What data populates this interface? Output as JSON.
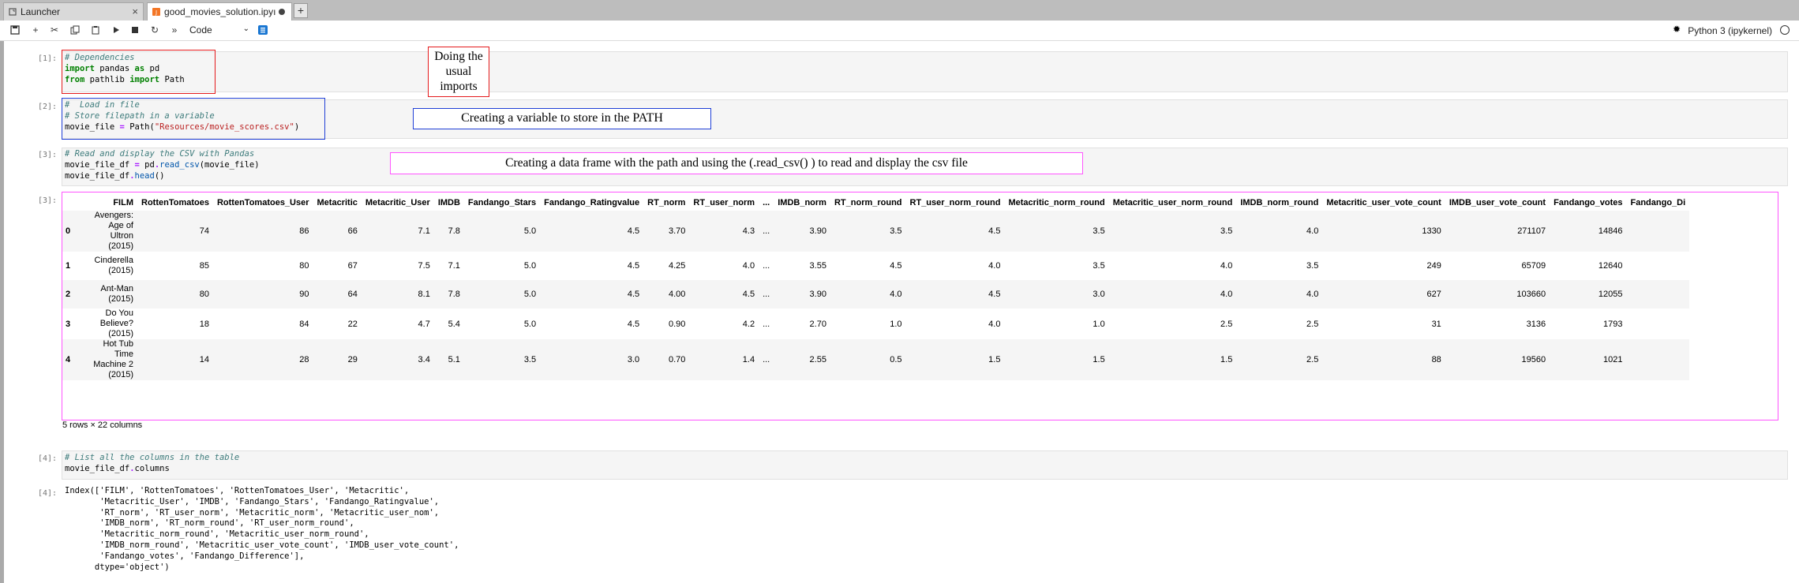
{
  "tabs": [
    {
      "label": "Launcher",
      "icon": "launcher-icon"
    },
    {
      "label": "good_movies_solution.ipyı",
      "icon": "notebook-icon"
    }
  ],
  "toolbar": {
    "cell_type": "Code",
    "kernel": "Python 3 (ipykernel)"
  },
  "cells": [
    {
      "prompt": "[1]:",
      "code": [
        "# Dependencies",
        "import pandas as pd",
        "from pathlib import Path"
      ]
    },
    {
      "prompt": "[2]:",
      "code": [
        "# Load in file",
        "# Store filepath in a variable",
        "movie_file = Path(\"Resources/movie_scores.csv\")"
      ]
    },
    {
      "prompt": "[3]:",
      "code": [
        "# Read and display the CSV with Pandas",
        "movie_file_df = pd.read_csv(movie_file)",
        "movie_file_df.head()"
      ]
    },
    {
      "prompt": "[4]:",
      "code": [
        "# List all the columns in the table",
        "movie_file_df.columns"
      ]
    }
  ],
  "annotations": {
    "imports": "Doing the usual imports",
    "path": "Creating a variable to store in the PATH",
    "dataframe": "Creating a data frame with the path and using the (.read_csv() ) to read and display the csv file"
  },
  "output3": {
    "prompt": "[3]:",
    "columns": [
      "",
      "FILM",
      "RottenTomatoes",
      "RottenTomatoes_User",
      "Metacritic",
      "Metacritic_User",
      "IMDB",
      "Fandango_Stars",
      "Fandango_Ratingvalue",
      "RT_norm",
      "RT_user_norm",
      "...",
      "IMDB_norm",
      "RT_norm_round",
      "RT_user_norm_round",
      "Metacritic_norm_round",
      "Metacritic_user_norm_round",
      "IMDB_norm_round",
      "Metacritic_user_vote_count",
      "IMDB_user_vote_count",
      "Fandango_votes",
      "Fandango_Di"
    ],
    "rows": [
      [
        "0",
        "Avengers: Age of Ultron (2015)",
        "74",
        "86",
        "66",
        "7.1",
        "7.8",
        "5.0",
        "4.5",
        "3.70",
        "4.3",
        "...",
        "3.90",
        "3.5",
        "4.5",
        "3.5",
        "3.5",
        "4.0",
        "1330",
        "271107",
        "14846",
        ""
      ],
      [
        "1",
        "Cinderella (2015)",
        "85",
        "80",
        "67",
        "7.5",
        "7.1",
        "5.0",
        "4.5",
        "4.25",
        "4.0",
        "...",
        "3.55",
        "4.5",
        "4.0",
        "3.5",
        "4.0",
        "3.5",
        "249",
        "65709",
        "12640",
        ""
      ],
      [
        "2",
        "Ant-Man (2015)",
        "80",
        "90",
        "64",
        "8.1",
        "7.8",
        "5.0",
        "4.5",
        "4.00",
        "4.5",
        "...",
        "3.90",
        "4.0",
        "4.5",
        "3.0",
        "4.0",
        "4.0",
        "627",
        "103660",
        "12055",
        ""
      ],
      [
        "3",
        "Do You Believe? (2015)",
        "18",
        "84",
        "22",
        "4.7",
        "5.4",
        "5.0",
        "4.5",
        "0.90",
        "4.2",
        "...",
        "2.70",
        "1.0",
        "4.0",
        "1.0",
        "2.5",
        "2.5",
        "31",
        "3136",
        "1793",
        ""
      ],
      [
        "4",
        "Hot Tub Time Machine 2 (2015)",
        "14",
        "28",
        "29",
        "3.4",
        "5.1",
        "3.5",
        "3.0",
        "0.70",
        "1.4",
        "...",
        "2.55",
        "0.5",
        "1.5",
        "1.5",
        "1.5",
        "2.5",
        "88",
        "19560",
        "1021",
        ""
      ]
    ],
    "shape": "5 rows × 22 columns"
  },
  "output4": {
    "prompt": "[4]:",
    "lines": [
      "Index(['FILM', 'RottenTomatoes', 'RottenTomatoes_User', 'Metacritic',",
      "       'Metacritic_User', 'IMDB', 'Fandango_Stars', 'Fandango_Ratingvalue',",
      "       'RT_norm', 'RT_user_norm', 'Metacritic_norm', 'Metacritic_user_nom',",
      "       'IMDB_norm', 'RT_norm_round', 'RT_user_norm_round',",
      "       'Metacritic_norm_round', 'Metacritic_user_norm_round',",
      "       'IMDB_norm_round', 'Metacritic_user_vote_count', 'IMDB_user_vote_count',",
      "       'Fandango_votes', 'Fandango_Difference'],",
      "      dtype='object')"
    ]
  },
  "colors": {
    "annotation_red": "#e41a1c",
    "annotation_blue": "#1f3fd6",
    "annotation_magenta": "#ff55ff"
  }
}
